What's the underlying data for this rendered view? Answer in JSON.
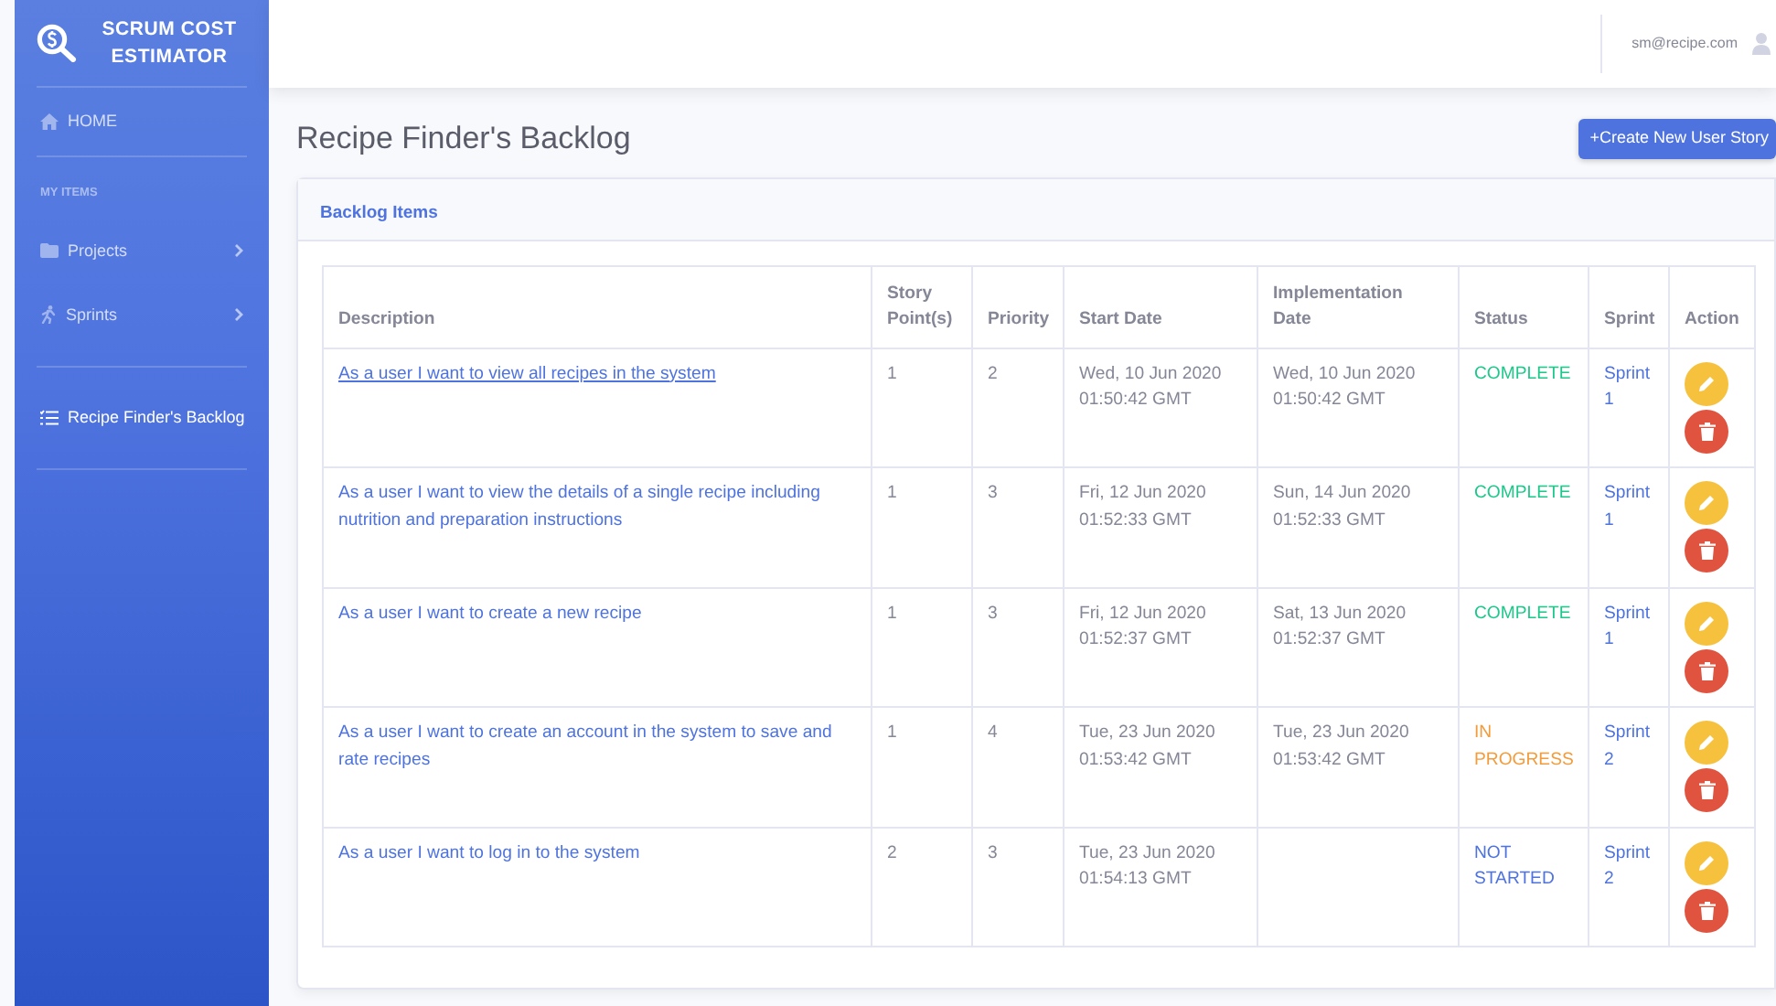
{
  "sidebar": {
    "brand": "SCRUM COST ESTIMATOR",
    "items": [
      {
        "kind": "link",
        "label": "HOME",
        "selected": false
      },
      {
        "kind": "heading",
        "label": "MY ITEMS"
      },
      {
        "kind": "collapse",
        "label": "Projects",
        "selected": false,
        "expanded": false
      },
      {
        "kind": "collapse",
        "label": "Sprints",
        "selected": false,
        "expanded": false
      },
      {
        "kind": "link",
        "label": "Recipe Finder's Backlog",
        "selected": true
      }
    ]
  },
  "topbar": {
    "user": "sm@recipe.com"
  },
  "page_title": "Recipe Finder's Backlog",
  "create_button": "+Create New User Story",
  "card": {
    "title": "Backlog Items",
    "table": {
      "columns": [
        "Description",
        "Story Point(s)",
        "Priority",
        "Start Date",
        "Implementation Date",
        "Status",
        "Sprint",
        "Action"
      ],
      "rows": [
        {
          "description": "As a user I want to view all recipes in the system",
          "underlined": true,
          "points": "1",
          "priority": "2",
          "start": "Wed, 10 Jun 2020 01:50:42 GMT",
          "implementation": "Wed, 10 Jun 2020 01:50:42 GMT",
          "status": "COMPLETE",
          "color": "#1cc88a",
          "sprint": "Sprint 1"
        },
        {
          "description": "As a user I want to view the details of a single recipe including nutrition and preparation instructions",
          "underlined": false,
          "points": "1",
          "priority": "3",
          "start": "Fri, 12 Jun 2020 01:52:33 GMT",
          "implementation": "Sun, 14 Jun 2020 01:52:33 GMT",
          "status": "COMPLETE",
          "color": "#1cc88a",
          "sprint": "Sprint 1"
        },
        {
          "description": "As a user I want to create a new recipe",
          "underlined": false,
          "points": "1",
          "priority": "3",
          "start": "Fri, 12 Jun 2020 01:52:37 GMT",
          "implementation": "Sat, 13 Jun 2020 01:52:37 GMT",
          "status": "COMPLETE",
          "color": "#1cc88a",
          "sprint": "Sprint 1"
        },
        {
          "description": "As a user I want to create an account in the system to save and rate recipes",
          "underlined": false,
          "points": "1",
          "priority": "4",
          "start": "Tue, 23 Jun 2020 01:53:42 GMT",
          "implementation": "Tue, 23 Jun 2020 01:53:42 GMT",
          "status": "IN PROGRESS",
          "color": "#f39c3c",
          "sprint": "Sprint 2"
        },
        {
          "description": "As a user I want to log in to the system",
          "underlined": false,
          "points": "2",
          "priority": "3",
          "start": "Tue, 23 Jun 2020 01:54:13 GMT",
          "status": "NOT STARTED",
          "color": "#4e73df",
          "sprint": "Sprint 2"
        }
      ]
    }
  }
}
